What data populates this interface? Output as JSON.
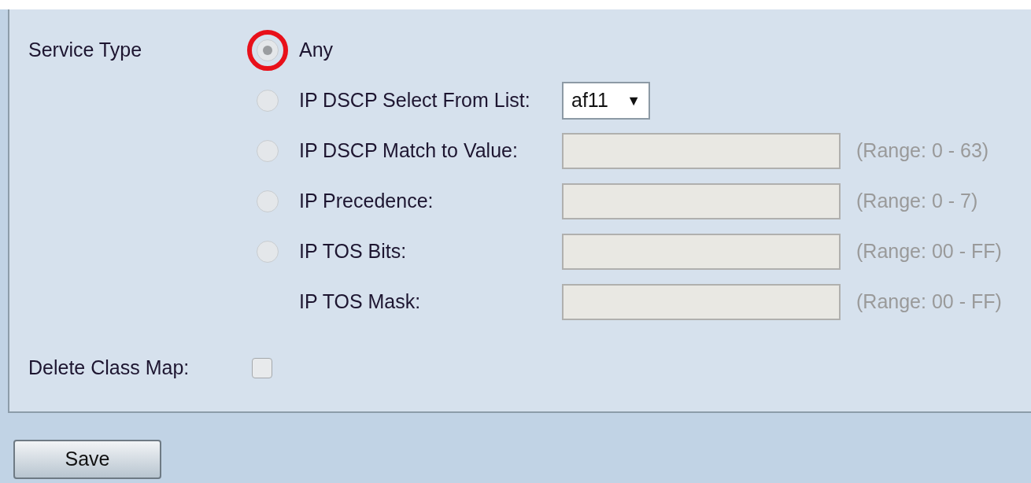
{
  "service_type": {
    "label": "Service Type",
    "options": [
      {
        "kind": "radio",
        "label": "Any",
        "selected": true,
        "highlighted": true
      },
      {
        "kind": "radio",
        "label": "IP DSCP Select From List:",
        "selected": false,
        "highlighted": false,
        "control": {
          "kind": "select",
          "value": "af11",
          "arrow": "▼"
        }
      },
      {
        "kind": "radio",
        "label": "IP DSCP Match to Value:",
        "selected": false,
        "highlighted": false,
        "control": {
          "kind": "input"
        },
        "range": "(Range: 0 - 63)"
      },
      {
        "kind": "radio",
        "label": "IP Precedence:",
        "selected": false,
        "highlighted": false,
        "control": {
          "kind": "input"
        },
        "range": "(Range: 0 - 7)"
      },
      {
        "kind": "radio",
        "label": "IP TOS Bits:",
        "selected": false,
        "highlighted": false,
        "control": {
          "kind": "input"
        },
        "range": "(Range: 00 - FF)"
      },
      {
        "kind": "plain",
        "label": "IP TOS Mask:",
        "control": {
          "kind": "input"
        },
        "range": "(Range: 00 - FF)"
      }
    ]
  },
  "delete_class_map": {
    "label": "Delete Class Map:",
    "checked": false
  },
  "buttons": [
    {
      "label": "Save"
    }
  ]
}
